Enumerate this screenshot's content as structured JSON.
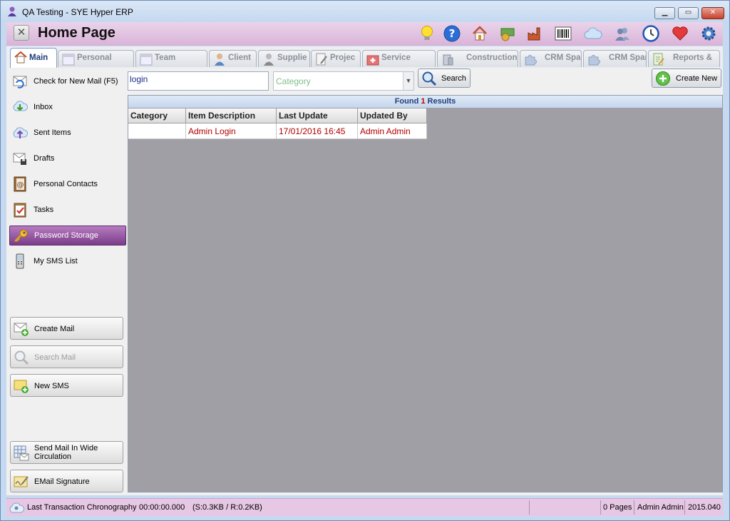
{
  "window": {
    "title": "QA Testing - SYE Hyper ERP"
  },
  "header": {
    "page_title": "Home Page"
  },
  "toolbar_icons": [
    "lightbulb-icon",
    "help-icon",
    "home-icon",
    "finance-icon",
    "factory-icon",
    "barcode-icon",
    "cloud-icon",
    "users-icon",
    "clock-icon",
    "heart-icon",
    "settings-icon"
  ],
  "tabs": [
    {
      "label": "Main",
      "active": true
    },
    {
      "label": "Personal"
    },
    {
      "label": "Team"
    },
    {
      "label": "Client"
    },
    {
      "label": "Supplie"
    },
    {
      "label": "Projec"
    },
    {
      "label": "Service"
    },
    {
      "label": "Construction"
    },
    {
      "label": "CRM Spar"
    },
    {
      "label": "CRM Spar"
    },
    {
      "label": "Reports &"
    }
  ],
  "sidebar": {
    "items": [
      {
        "label": "Check for New Mail  (F5)"
      },
      {
        "label": "Inbox"
      },
      {
        "label": "Sent Items"
      },
      {
        "label": "Drafts"
      },
      {
        "label": "Personal Contacts"
      },
      {
        "label": "Tasks"
      },
      {
        "label": "Password Storage",
        "active": true
      },
      {
        "label": "My SMS List"
      }
    ],
    "buttons": {
      "create_mail": "Create Mail",
      "search_mail": "Search Mail",
      "new_sms": "New SMS",
      "send_wide_1": "Send Mail In Wide",
      "send_wide_2": "Circulation",
      "email_signature": "EMail Signature"
    }
  },
  "search": {
    "value": "login",
    "category_placeholder": "Category",
    "search_label": "Search",
    "create_new_label": "Create New"
  },
  "results": {
    "found_prefix": "Found",
    "found_count": "1",
    "found_suffix": "Results",
    "columns": [
      "Category",
      "Item Description",
      "Last Update",
      "Updated By"
    ],
    "rows": [
      {
        "category": "",
        "description": "Admin Login",
        "last_update": "17/01/2016 16:45",
        "updated_by": "Admin Admin"
      }
    ]
  },
  "status": {
    "chronography_label": "Last Transaction Chronography",
    "time": "00:00:00.000",
    "transfer": "(S:0.3KB / R:0.2KB)",
    "pages": "0 Pages",
    "user": "Admin Admin",
    "version": "2015.040"
  },
  "colors": {
    "accent_purple": "#8a4a98",
    "header_pink": "#d9b3d8",
    "grid_bg": "#a09fa5",
    "value_red": "#b00000"
  }
}
